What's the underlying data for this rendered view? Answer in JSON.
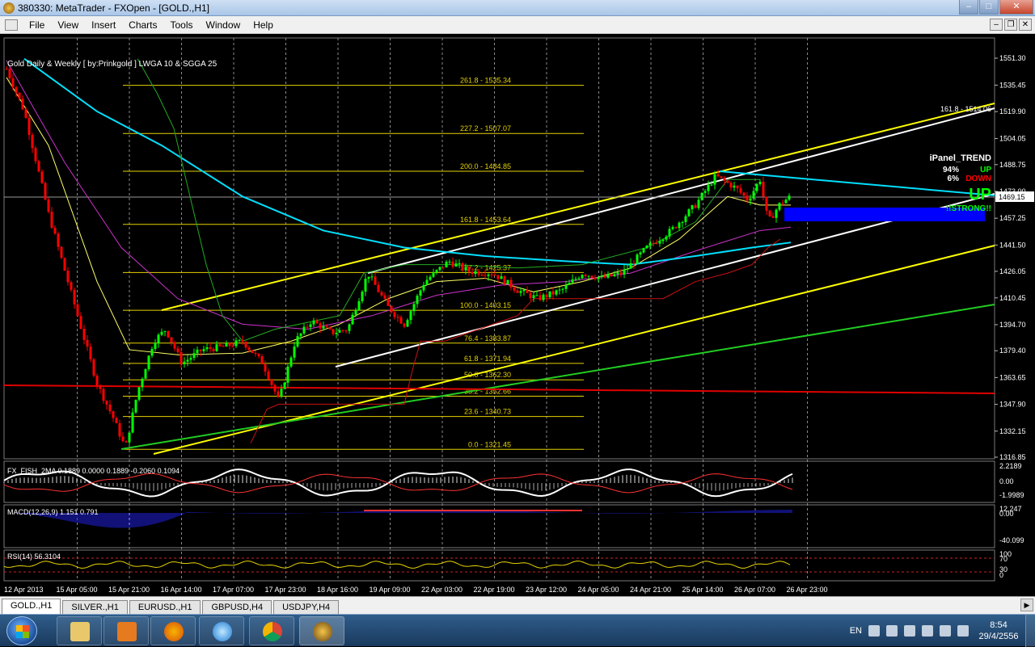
{
  "window": {
    "title": "380330: MetaTrader - FXOpen - [GOLD.,H1]",
    "btn_min": "–",
    "btn_max": "□",
    "btn_close": "✕"
  },
  "menu": [
    "File",
    "View",
    "Insert",
    "Charts",
    "Tools",
    "Window",
    "Help"
  ],
  "mdi": {
    "min": "–",
    "restore": "❐",
    "close": "✕"
  },
  "chart": {
    "header": "Gold Daily & Weekly [ by:Prinkgold ]  LWGA 10  &  SGGA 25",
    "price_axis": [
      "1551.30",
      "1535.45",
      "1519.90",
      "1504.05",
      "1488.75",
      "1473.00",
      "1457.25",
      "1441.50",
      "1426.05",
      "1410.45",
      "1394.70",
      "1379.40",
      "1363.65",
      "1347.90",
      "1332.15",
      "1316.85"
    ],
    "current_price": "1469.15",
    "fib_levels": [
      "261.8 - 1535.34",
      "227.2 - 1507.07",
      "200.0 - 1484.85",
      "161.8 - 1453.64",
      "127.2 - 1425.37",
      "100.0 - 1403.15",
      "76.4 - 1383.87",
      "61.8 - 1371.94",
      "50.0 - 1362.30",
      "38.2 - 1352.66",
      "23.6 - 1340.73",
      "0.0 - 1321.45"
    ],
    "fib_ext_label": "161.8 - 1514.06",
    "ipanel": {
      "title": "iPanel_TREND",
      "up_pct": "94%",
      "up_label": "UP",
      "down_pct": "6%",
      "down_label": "DOWN",
      "big": "UP",
      "strong": "!!STRONG!!"
    },
    "fish": {
      "label": "FX_FISH_2MA 0.1889 0.0000 0.1889 -0.2060 0.1094",
      "axis": [
        "2.2189",
        "0.00",
        "-1.9989"
      ]
    },
    "macd": {
      "label": "MACD(12,26,9) 1.151 0.791",
      "axis": [
        "12.247",
        "0.00",
        "-40.099"
      ]
    },
    "rsi": {
      "label": "RSI(14) 56.3104",
      "axis": [
        "100",
        "70",
        "30",
        "0"
      ]
    },
    "time_axis": [
      "12 Apr 2013",
      "15 Apr 05:00",
      "15 Apr 21:00",
      "16 Apr 14:00",
      "17 Apr 07:00",
      "17 Apr 23:00",
      "18 Apr 16:00",
      "19 Apr 09:00",
      "22 Apr 03:00",
      "22 Apr 19:00",
      "23 Apr 12:00",
      "24 Apr 05:00",
      "24 Apr 21:00",
      "25 Apr 14:00",
      "26 Apr 07:00",
      "26 Apr 23:00"
    ],
    "colors": {
      "bull": "#00ff00",
      "bear": "#ff0000",
      "channel": "#ffff00",
      "fib": "#ffff00",
      "ma_slow": "#00e0ff"
    }
  },
  "tabs": [
    "GOLD.,H1",
    "SILVER.,H1",
    "EURUSD.,H1",
    "GBPUSD,H4",
    "USDJPY,H4"
  ],
  "tray": {
    "lang": "EN",
    "time": "8:54",
    "date": "29/4/2556"
  }
}
